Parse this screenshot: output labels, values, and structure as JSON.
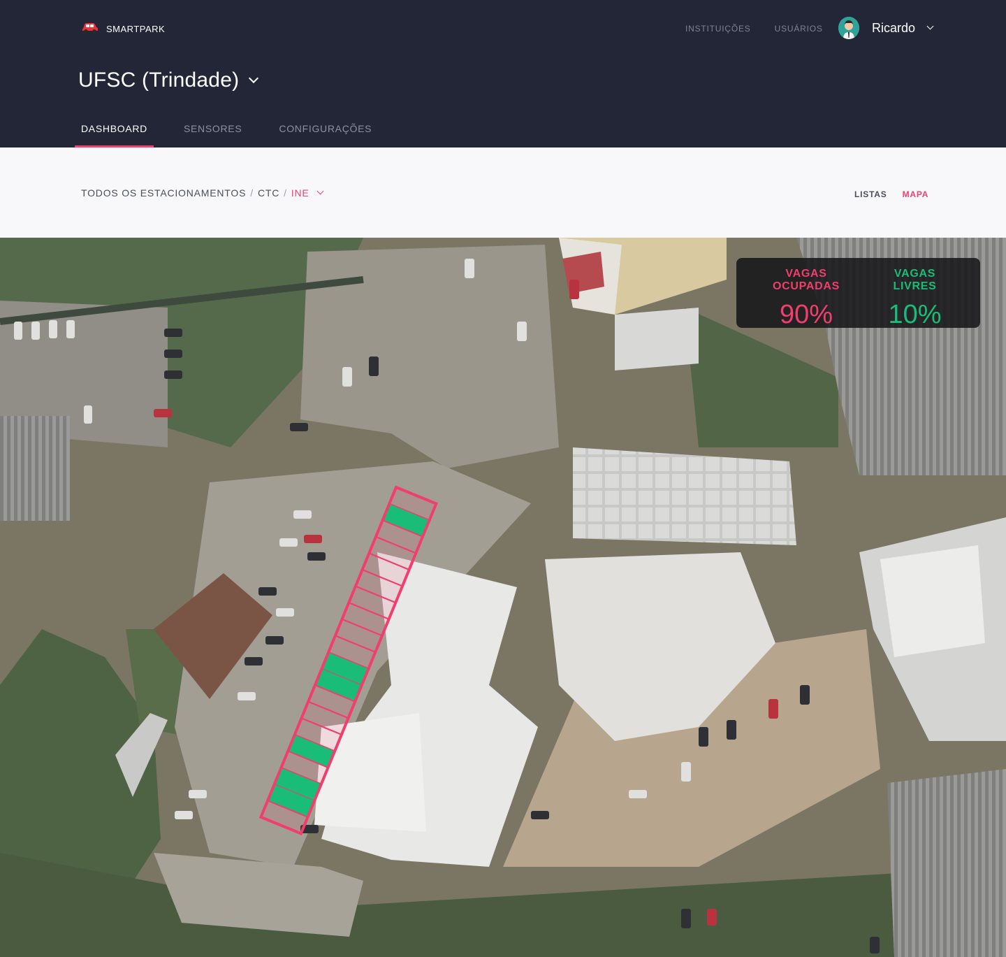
{
  "brand": {
    "name": "SMARTPARK",
    "icon": "car-icon"
  },
  "topnav": {
    "items": [
      "INSTITUIÇÕES",
      "USUÁRIOS"
    ]
  },
  "user": {
    "name": "Ricardo",
    "avatar": "avatar"
  },
  "institution": {
    "name": "UFSC (Trindade)"
  },
  "tabs": [
    {
      "label": "DASHBOARD",
      "active": true
    },
    {
      "label": "SENSORES",
      "active": false
    },
    {
      "label": "CONFIGURAÇÕES",
      "active": false
    }
  ],
  "breadcrumb": {
    "root": "TODOS OS ESTACIONAMENTOS",
    "level1": "CTC",
    "current": "INE",
    "separator": "/"
  },
  "view_toggle": {
    "listas": "LISTAS",
    "mapa": "MAPA",
    "selected": "MAPA"
  },
  "stats": {
    "occupied_label": "VAGAS OCUPADAS",
    "occupied_value": "90%",
    "free_label": "VAGAS LIVRES",
    "free_value": "10%"
  },
  "parking": {
    "total_spots": 20,
    "free_spots": [
      2,
      11,
      12,
      16,
      18,
      19
    ],
    "colors": {
      "occupied": "#f03e6d",
      "free": "#19bd78"
    }
  },
  "colors": {
    "header": "#222636",
    "accent": "#f03e6d",
    "free": "#19bd78"
  }
}
